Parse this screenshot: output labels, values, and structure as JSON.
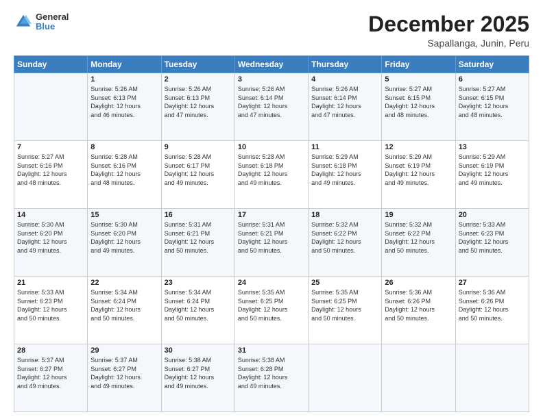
{
  "logo": {
    "general": "General",
    "blue": "Blue"
  },
  "header": {
    "month": "December 2025",
    "location": "Sapallanga, Junin, Peru"
  },
  "days_of_week": [
    "Sunday",
    "Monday",
    "Tuesday",
    "Wednesday",
    "Thursday",
    "Friday",
    "Saturday"
  ],
  "weeks": [
    [
      {
        "day": "",
        "info": ""
      },
      {
        "day": "1",
        "info": "Sunrise: 5:26 AM\nSunset: 6:13 PM\nDaylight: 12 hours\nand 46 minutes."
      },
      {
        "day": "2",
        "info": "Sunrise: 5:26 AM\nSunset: 6:13 PM\nDaylight: 12 hours\nand 47 minutes."
      },
      {
        "day": "3",
        "info": "Sunrise: 5:26 AM\nSunset: 6:14 PM\nDaylight: 12 hours\nand 47 minutes."
      },
      {
        "day": "4",
        "info": "Sunrise: 5:26 AM\nSunset: 6:14 PM\nDaylight: 12 hours\nand 47 minutes."
      },
      {
        "day": "5",
        "info": "Sunrise: 5:27 AM\nSunset: 6:15 PM\nDaylight: 12 hours\nand 48 minutes."
      },
      {
        "day": "6",
        "info": "Sunrise: 5:27 AM\nSunset: 6:15 PM\nDaylight: 12 hours\nand 48 minutes."
      }
    ],
    [
      {
        "day": "7",
        "info": "Sunrise: 5:27 AM\nSunset: 6:16 PM\nDaylight: 12 hours\nand 48 minutes."
      },
      {
        "day": "8",
        "info": "Sunrise: 5:28 AM\nSunset: 6:16 PM\nDaylight: 12 hours\nand 48 minutes."
      },
      {
        "day": "9",
        "info": "Sunrise: 5:28 AM\nSunset: 6:17 PM\nDaylight: 12 hours\nand 49 minutes."
      },
      {
        "day": "10",
        "info": "Sunrise: 5:28 AM\nSunset: 6:18 PM\nDaylight: 12 hours\nand 49 minutes."
      },
      {
        "day": "11",
        "info": "Sunrise: 5:29 AM\nSunset: 6:18 PM\nDaylight: 12 hours\nand 49 minutes."
      },
      {
        "day": "12",
        "info": "Sunrise: 5:29 AM\nSunset: 6:19 PM\nDaylight: 12 hours\nand 49 minutes."
      },
      {
        "day": "13",
        "info": "Sunrise: 5:29 AM\nSunset: 6:19 PM\nDaylight: 12 hours\nand 49 minutes."
      }
    ],
    [
      {
        "day": "14",
        "info": "Sunrise: 5:30 AM\nSunset: 6:20 PM\nDaylight: 12 hours\nand 49 minutes."
      },
      {
        "day": "15",
        "info": "Sunrise: 5:30 AM\nSunset: 6:20 PM\nDaylight: 12 hours\nand 49 minutes."
      },
      {
        "day": "16",
        "info": "Sunrise: 5:31 AM\nSunset: 6:21 PM\nDaylight: 12 hours\nand 50 minutes."
      },
      {
        "day": "17",
        "info": "Sunrise: 5:31 AM\nSunset: 6:21 PM\nDaylight: 12 hours\nand 50 minutes."
      },
      {
        "day": "18",
        "info": "Sunrise: 5:32 AM\nSunset: 6:22 PM\nDaylight: 12 hours\nand 50 minutes."
      },
      {
        "day": "19",
        "info": "Sunrise: 5:32 AM\nSunset: 6:22 PM\nDaylight: 12 hours\nand 50 minutes."
      },
      {
        "day": "20",
        "info": "Sunrise: 5:33 AM\nSunset: 6:23 PM\nDaylight: 12 hours\nand 50 minutes."
      }
    ],
    [
      {
        "day": "21",
        "info": "Sunrise: 5:33 AM\nSunset: 6:23 PM\nDaylight: 12 hours\nand 50 minutes."
      },
      {
        "day": "22",
        "info": "Sunrise: 5:34 AM\nSunset: 6:24 PM\nDaylight: 12 hours\nand 50 minutes."
      },
      {
        "day": "23",
        "info": "Sunrise: 5:34 AM\nSunset: 6:24 PM\nDaylight: 12 hours\nand 50 minutes."
      },
      {
        "day": "24",
        "info": "Sunrise: 5:35 AM\nSunset: 6:25 PM\nDaylight: 12 hours\nand 50 minutes."
      },
      {
        "day": "25",
        "info": "Sunrise: 5:35 AM\nSunset: 6:25 PM\nDaylight: 12 hours\nand 50 minutes."
      },
      {
        "day": "26",
        "info": "Sunrise: 5:36 AM\nSunset: 6:26 PM\nDaylight: 12 hours\nand 50 minutes."
      },
      {
        "day": "27",
        "info": "Sunrise: 5:36 AM\nSunset: 6:26 PM\nDaylight: 12 hours\nand 50 minutes."
      }
    ],
    [
      {
        "day": "28",
        "info": "Sunrise: 5:37 AM\nSunset: 6:27 PM\nDaylight: 12 hours\nand 49 minutes."
      },
      {
        "day": "29",
        "info": "Sunrise: 5:37 AM\nSunset: 6:27 PM\nDaylight: 12 hours\nand 49 minutes."
      },
      {
        "day": "30",
        "info": "Sunrise: 5:38 AM\nSunset: 6:27 PM\nDaylight: 12 hours\nand 49 minutes."
      },
      {
        "day": "31",
        "info": "Sunrise: 5:38 AM\nSunset: 6:28 PM\nDaylight: 12 hours\nand 49 minutes."
      },
      {
        "day": "",
        "info": ""
      },
      {
        "day": "",
        "info": ""
      },
      {
        "day": "",
        "info": ""
      }
    ]
  ]
}
